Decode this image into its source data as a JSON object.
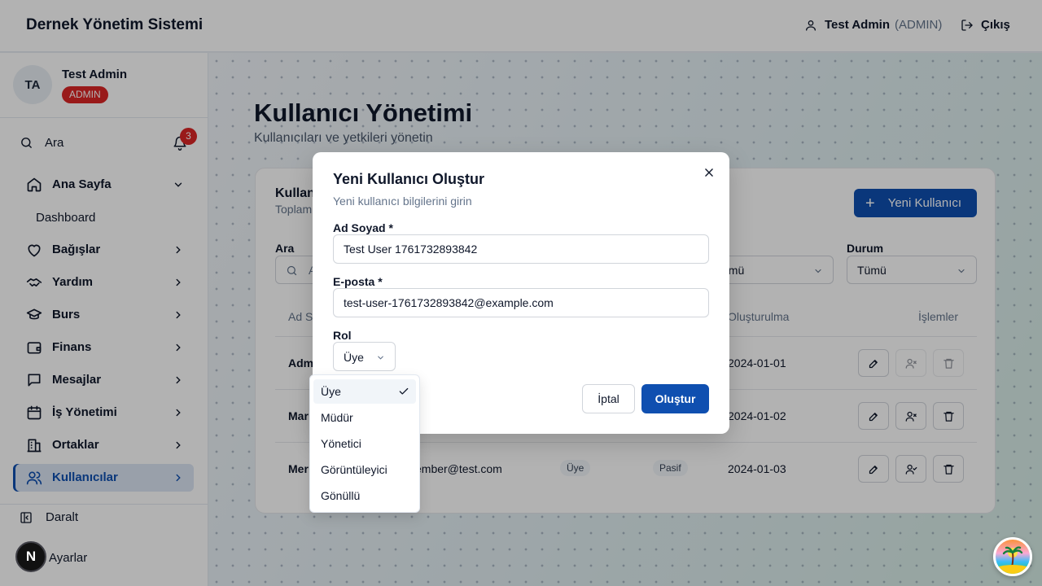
{
  "header": {
    "app_title": "Dernek Yönetim Sistemi",
    "user_name": "Test Admin",
    "user_role": "(ADMIN)",
    "logout_label": "Çıkış"
  },
  "sidebar": {
    "avatar_initials": "TA",
    "profile_name": "Test Admin",
    "profile_badge": "ADMIN",
    "search_label": "Ara",
    "notification_count": "3",
    "items": [
      {
        "label": "Ana Sayfa",
        "icon": "home-icon",
        "expanded": true
      },
      {
        "label": "Bağışlar",
        "icon": "heart-icon"
      },
      {
        "label": "Yardım",
        "icon": "handshake-icon"
      },
      {
        "label": "Burs",
        "icon": "graduation-cap-icon"
      },
      {
        "label": "Finans",
        "icon": "wallet-icon"
      },
      {
        "label": "Mesajlar",
        "icon": "message-icon"
      },
      {
        "label": "İş Yönetimi",
        "icon": "calendar-icon"
      },
      {
        "label": "Ortaklar",
        "icon": "building-icon"
      },
      {
        "label": "Kullanıcılar",
        "icon": "users-icon",
        "active": true
      }
    ],
    "sub_item": "Dashboard",
    "collapse_label": "Daralt",
    "settings_label": "Ayarlar"
  },
  "page": {
    "title": "Kullanıcı Yönetimi",
    "subtitle": "Kullanıcıları ve yetkileri yönetin"
  },
  "card": {
    "title": "Kullan",
    "subtitle": "Toplam",
    "new_user_label": "Yeni Kullanıcı",
    "search_label": "Ara",
    "search_placeholder": "A",
    "role_filter_value": "ümü",
    "status_filter_label": "Durum",
    "status_filter_value": "Tümü",
    "columns": [
      "Ad S",
      "Oluşturulma",
      "İşlemler"
    ],
    "rows": [
      {
        "name": "Adm",
        "email": "",
        "role": "",
        "status": "",
        "created": "2024-01-01"
      },
      {
        "name": "Mar",
        "email": "",
        "role": "",
        "status": "",
        "created": "2024-01-02"
      },
      {
        "name": "Mer",
        "email": "ember@test.com",
        "role": "Üye",
        "status": "Pasif",
        "created": "2024-01-03"
      }
    ]
  },
  "modal": {
    "title": "Yeni Kullanıcı Oluştur",
    "subtitle": "Yeni kullanıcı bilgilerini girin",
    "name_label": "Ad Soyad *",
    "name_value": "Test User 1761732893842",
    "email_label": "E-posta *",
    "email_value": "test-user-1761732893842@example.com",
    "role_label": "Rol",
    "role_value": "Üye",
    "cancel_label": "İptal",
    "create_label": "Oluştur"
  },
  "role_options": [
    "Üye",
    "Müdür",
    "Yönetici",
    "Görüntüleyici",
    "Gönüllü"
  ],
  "selected_role_option": "Üye",
  "colors": {
    "primary": "#0f4fb0",
    "danger": "#dc2626"
  }
}
